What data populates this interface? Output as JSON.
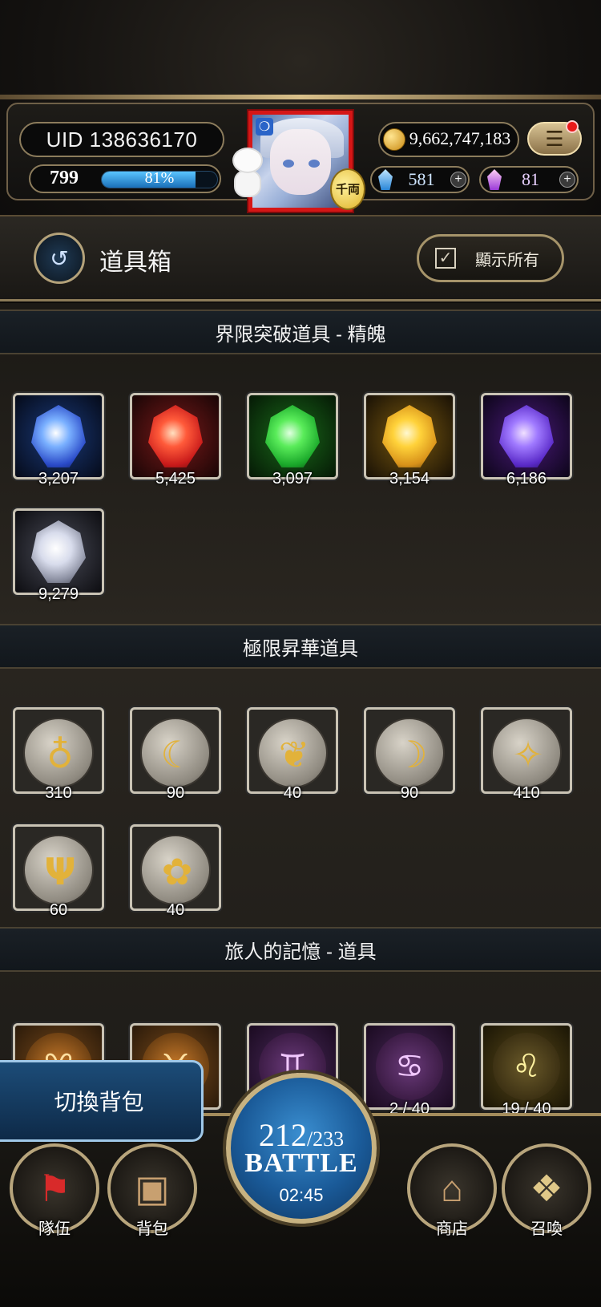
{
  "header": {
    "uid": "UID 138636170",
    "level": "799",
    "exp_percent_label": "81%",
    "exp_fraction": 0.81,
    "gold": "9,662,747,183",
    "avatar_badge_glyph": "千両",
    "blue_gem": "581",
    "purple_gem": "81",
    "plus_glyph": "+",
    "menu_glyph": "☰"
  },
  "title_bar": {
    "title": "道具箱",
    "show_all_label": "顯示所有",
    "back_glyph": "↺",
    "check_glyph": "✓"
  },
  "sections": [
    {
      "title": "界限突破道具 - 精魄",
      "items": [
        {
          "qty": "3,207",
          "icon": "blue-soul-icon",
          "color": "#3a7cff"
        },
        {
          "qty": "5,425",
          "icon": "red-soul-icon",
          "color": "#ff3a3a"
        },
        {
          "qty": "3,097",
          "icon": "green-soul-icon",
          "color": "#3adc4a"
        },
        {
          "qty": "3,154",
          "icon": "yellow-soul-icon",
          "color": "#ffc21a"
        },
        {
          "qty": "6,186",
          "icon": "purple-soul-icon",
          "color": "#8a4aff"
        },
        {
          "qty": "9,279",
          "icon": "white-soul-icon",
          "color": "#d8dcec"
        }
      ]
    },
    {
      "title": "極限昇華道具",
      "items": [
        {
          "qty": "310",
          "icon": "ankh-rune-icon",
          "glyph": "♁"
        },
        {
          "qty": "90",
          "icon": "wave-rune-icon",
          "glyph": "☾"
        },
        {
          "qty": "40",
          "icon": "leaf-rune-icon",
          "glyph": "❦"
        },
        {
          "qty": "90",
          "icon": "crescent-rune-icon",
          "glyph": "☽"
        },
        {
          "qty": "410",
          "icon": "star-rune-icon",
          "glyph": "✧"
        },
        {
          "qty": "60",
          "icon": "wing-rune-icon",
          "glyph": "Ψ"
        },
        {
          "qty": "40",
          "icon": "gear-rune-icon",
          "glyph": "✿"
        }
      ]
    },
    {
      "title": "旅人的記憶 - 道具",
      "items": [
        {
          "qty": "",
          "icon": "aries-zodiac-icon",
          "glyph": "♈"
        },
        {
          "qty": "",
          "icon": "taurus-zodiac-icon",
          "glyph": "♉"
        },
        {
          "qty": "",
          "icon": "gemini-zodiac-icon",
          "glyph": "♊"
        },
        {
          "qty": "2 / 40",
          "icon": "cancer-zodiac-icon",
          "glyph": "♋"
        },
        {
          "qty": "19 / 40",
          "icon": "leo-zodiac-icon",
          "glyph": "♌"
        }
      ]
    }
  ],
  "bottom": {
    "switch_bag": "切換背包",
    "team": "隊伍",
    "bag": "背包",
    "shop": "商店",
    "summon": "召喚",
    "stamina_current": "212",
    "stamina_max": "/233",
    "battle": "BATTLE",
    "timer": "02:45"
  }
}
